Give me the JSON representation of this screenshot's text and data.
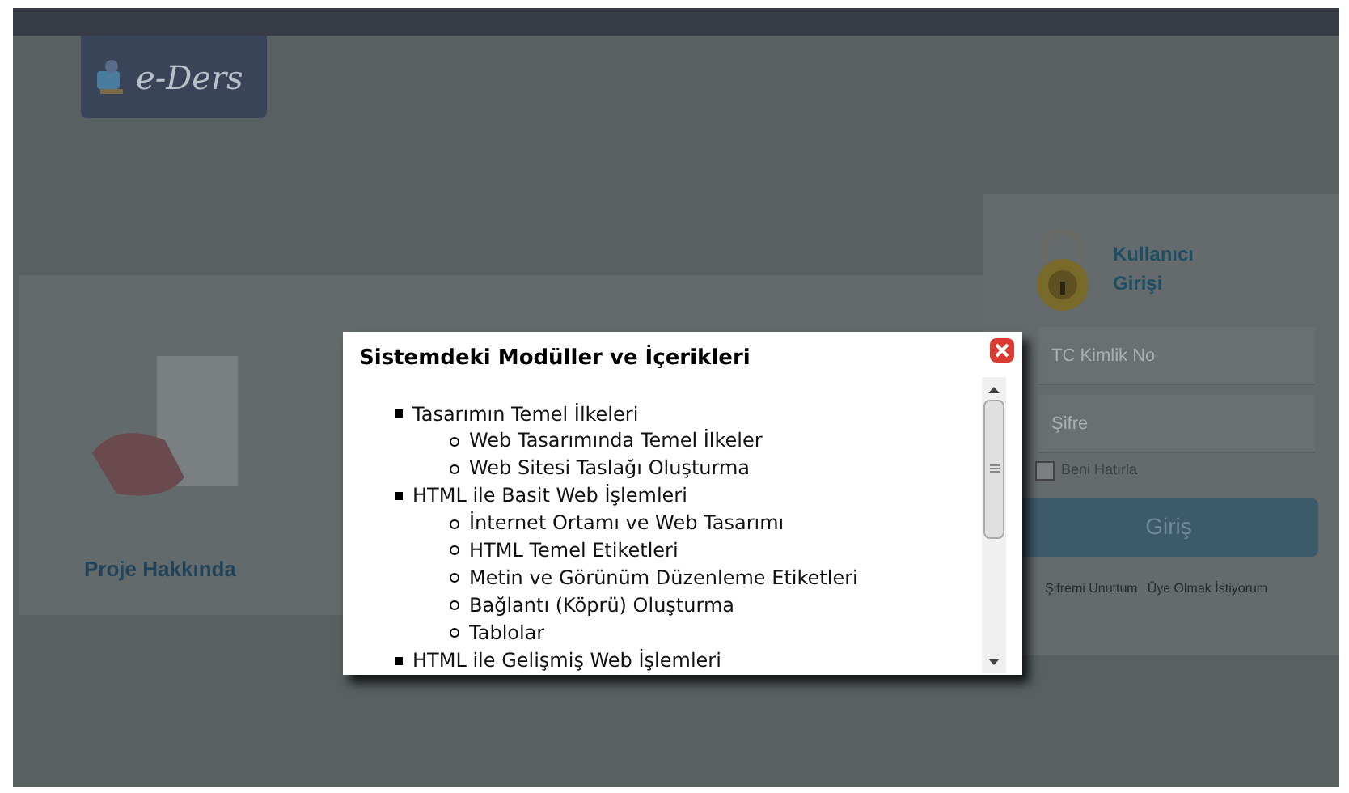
{
  "header": {
    "logo_text": "e-Ders"
  },
  "project_card": {
    "label": "Proje Hakkında"
  },
  "login": {
    "title": "Kullanıcı Girişi",
    "fields": [
      {
        "placeholder": "TC Kimlik No"
      },
      {
        "placeholder": "Şifre"
      }
    ],
    "remember": {
      "label": "Beni Hatırla",
      "checked": false
    },
    "submit": "Giriş",
    "links": [
      "Şifremi Unuttum",
      "Üye Olmak İstiyorum"
    ]
  },
  "modal": {
    "title": "Sistemdeki Modüller ve İçerikleri",
    "modules": [
      {
        "label": "Tasarımın Temel İlkeleri",
        "children": [
          {
            "label": "Web Tasarımında Temel İlkeler"
          },
          {
            "label": "Web Sitesi Taslağı Oluşturma"
          }
        ]
      },
      {
        "label": "HTML ile Basit Web İşlemleri",
        "children": [
          {
            "label": "İnternet Ortamı ve Web Tasarımı"
          },
          {
            "label": "HTML Temel Etiketleri"
          },
          {
            "label": "Metin ve Görünüm Düzenleme Etiketleri"
          },
          {
            "label": "Bağlantı (Köprü) Oluşturma"
          },
          {
            "label": "Tablolar"
          }
        ]
      },
      {
        "label": "HTML ile Gelişmiş Web İşlemleri"
      }
    ]
  }
}
